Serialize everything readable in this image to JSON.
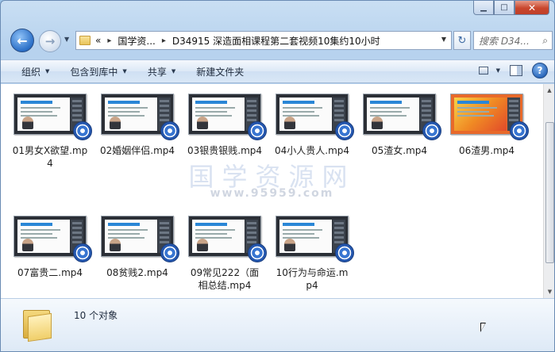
{
  "window": {
    "caption": {
      "minimize": "▁",
      "maximize": "□",
      "close": "✕"
    }
  },
  "nav": {
    "back": "←",
    "forward": "→",
    "address": {
      "overflow": "«",
      "crumbs": [
        "国学资...",
        "D34915 深造面相课程第二套视频10集约10小时"
      ],
      "separator": "▸"
    },
    "refresh": "↻",
    "search_placeholder": "搜索 D34...",
    "search_icon": "⌕"
  },
  "toolbar": {
    "organize": "组织",
    "include_library": "包含到库中",
    "share": "共享",
    "new_folder": "新建文件夹",
    "help": "?"
  },
  "files": [
    {
      "name": "01男女X欲望.mp4"
    },
    {
      "name": "02婚姻伴侣.mp4"
    },
    {
      "name": "03银贵银贱.mp4"
    },
    {
      "name": "04小人贵人.mp4"
    },
    {
      "name": "05渣女.mp4"
    },
    {
      "name": "06渣男.mp4"
    },
    {
      "name": "07富贵二.mp4"
    },
    {
      "name": "08贫贱2.mp4"
    },
    {
      "name": "09常见222（面相总结.mp4"
    },
    {
      "name": "10行为与命运.mp4"
    }
  ],
  "watermark": {
    "line1": "国学资源网",
    "line2": "www.95959.com"
  },
  "status": {
    "count": "10 个对象"
  },
  "colors": {
    "accent": "#2b6fc7",
    "close": "#c8462c",
    "folder": "#f0cf6a"
  }
}
